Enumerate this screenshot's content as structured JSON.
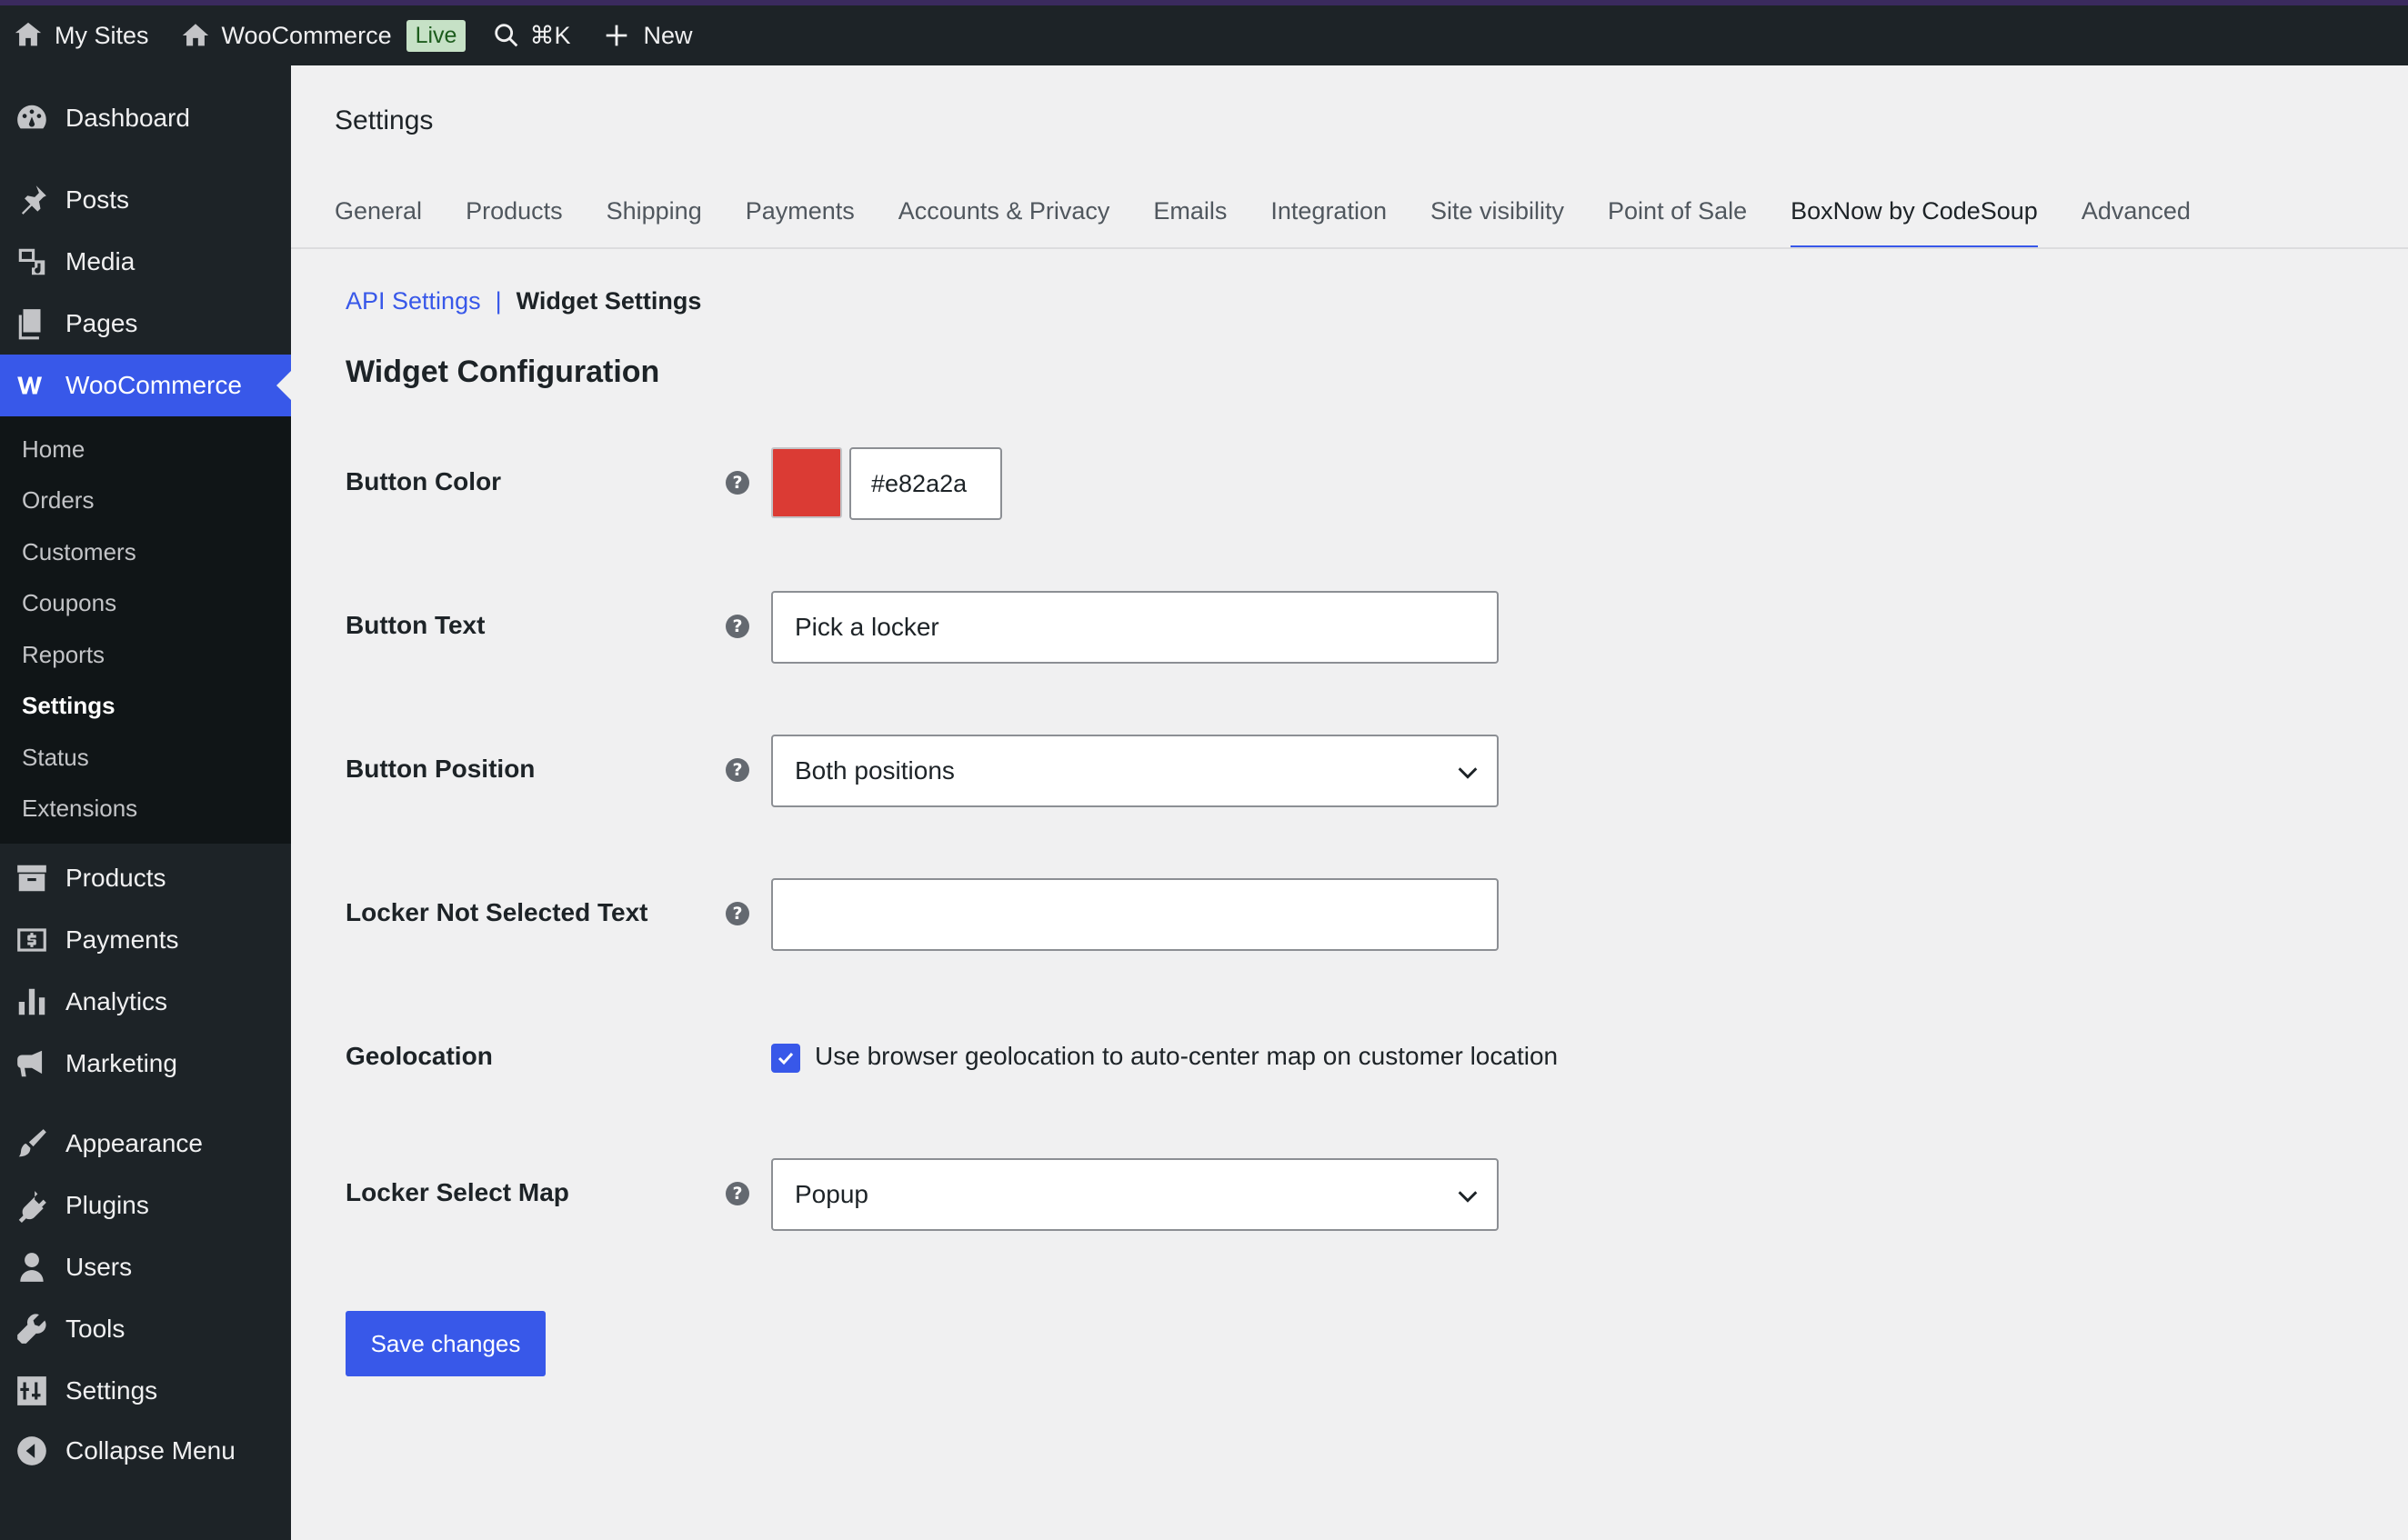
{
  "adminbar": {
    "my_sites": "My Sites",
    "site_name": "WooCommerce",
    "live_badge": "Live",
    "search_shortcut": "⌘K",
    "new_label": "New"
  },
  "sidebar": {
    "items_top": [
      {
        "label": "Dashboard",
        "icon": "dashboard-icon"
      },
      {
        "label": "Posts",
        "icon": "pin-icon"
      },
      {
        "label": "Media",
        "icon": "media-icon"
      },
      {
        "label": "Pages",
        "icon": "pages-icon"
      },
      {
        "label": "WooCommerce",
        "icon": "woo-icon"
      }
    ],
    "woo_submenu": [
      "Home",
      "Orders",
      "Customers",
      "Coupons",
      "Reports",
      "Settings",
      "Status",
      "Extensions"
    ],
    "items_bottom": [
      {
        "label": "Products",
        "icon": "archive-icon"
      },
      {
        "label": "Payments",
        "icon": "dollar-icon"
      },
      {
        "label": "Analytics",
        "icon": "bar-chart-icon"
      },
      {
        "label": "Marketing",
        "icon": "megaphone-icon"
      },
      {
        "label": "Appearance",
        "icon": "brush-icon"
      },
      {
        "label": "Plugins",
        "icon": "plug-icon"
      },
      {
        "label": "Users",
        "icon": "user-icon"
      },
      {
        "label": "Tools",
        "icon": "wrench-icon"
      },
      {
        "label": "Settings",
        "icon": "sliders-icon"
      },
      {
        "label": "Collapse Menu",
        "icon": "collapse-icon"
      }
    ]
  },
  "page": {
    "heading": "Settings",
    "tabs": [
      "General",
      "Products",
      "Shipping",
      "Payments",
      "Accounts & Privacy",
      "Emails",
      "Integration",
      "Site visibility",
      "Point of Sale",
      "BoxNow by CodeSoup",
      "Advanced"
    ],
    "active_tab": "BoxNow by CodeSoup",
    "subnav": {
      "api": "API Settings",
      "sep": "|",
      "widget": "Widget Settings"
    },
    "section_title": "Widget Configuration"
  },
  "form": {
    "button_color": {
      "label": "Button Color",
      "value": "#e82a2a",
      "swatch_color": "#db3b34"
    },
    "button_text": {
      "label": "Button Text",
      "value": "Pick a locker"
    },
    "button_position": {
      "label": "Button Position",
      "value": "Both positions"
    },
    "locker_not_selected": {
      "label": "Locker Not Selected Text",
      "value": ""
    },
    "geolocation": {
      "label": "Geolocation",
      "checkbox_label": "Use browser geolocation to auto-center map on customer location",
      "checked": true
    },
    "locker_select_map": {
      "label": "Locker Select Map",
      "value": "Popup"
    },
    "save_label": "Save changes"
  },
  "colors": {
    "accent": "#3858e9",
    "adminbar": "#1d2327",
    "background": "#f0f0f1"
  }
}
